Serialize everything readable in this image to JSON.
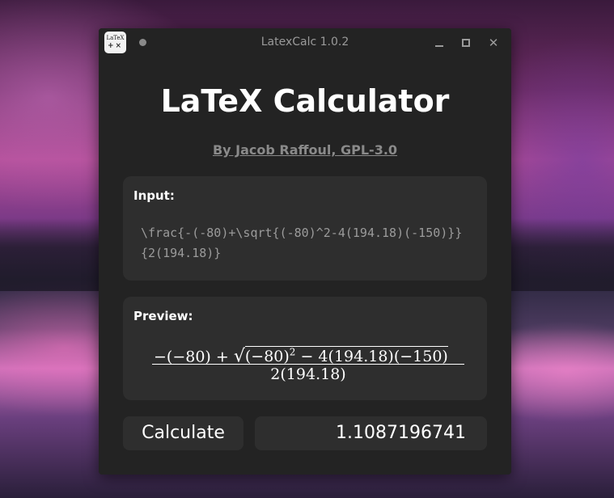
{
  "window": {
    "title": "LatexCalc 1.0.2",
    "icon_text_top": "LaTeX",
    "icon_text_bottom": "+×",
    "controls": {
      "minimize": "minimize-icon",
      "maximize": "maximize-icon",
      "close": "close-icon"
    }
  },
  "header": {
    "title": "LaTeX Calculator",
    "byline": "By Jacob Raffoul, GPL-3.0"
  },
  "input": {
    "label": "Input:",
    "value": "\\frac{-(-80)+\\sqrt{(-80)^2-4(194.18)(-150)}}{2(194.18)}"
  },
  "preview": {
    "label": "Preview:",
    "numerator_prefix": "−(−80) + ",
    "sqrt_symbol": "√",
    "radicand_base": "(−80)",
    "radicand_exponent": "2",
    "radicand_rest": " − 4(194.18)(−150)",
    "denominator": "2(194.18)"
  },
  "actions": {
    "calculate_label": "Calculate",
    "result": "1.1087196741"
  },
  "colors": {
    "window_bg": "#232323",
    "panel_bg": "#2e2e2e",
    "heading": "#ffffff",
    "muted_text": "#8a8a8a"
  }
}
